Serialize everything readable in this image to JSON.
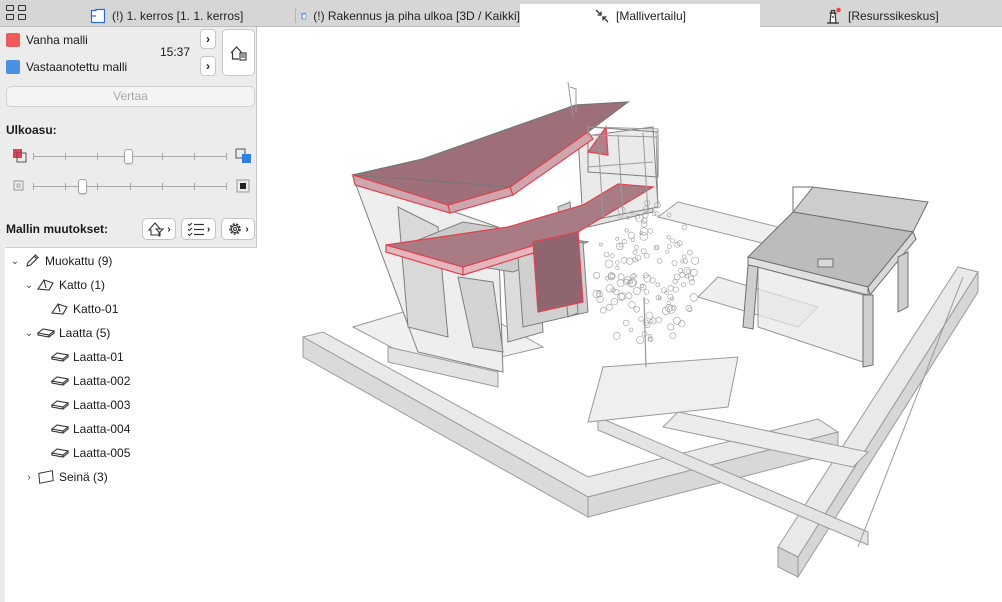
{
  "tabs": [
    {
      "label": "(!) 1. kerros [1. 1. kerros]",
      "icon": "floor-plan-icon"
    },
    {
      "label": "(!) Rakennus ja piha ulkoa [3D / Kaikki]",
      "icon": "3d-view-icon"
    },
    {
      "label": "[Mallivertailu]",
      "icon": "model-compare-icon"
    },
    {
      "label": "[Resurssikeskus]",
      "icon": "resource-center-icon"
    }
  ],
  "models": {
    "old_label": "Vanha malli",
    "old_color": "#f05a5a",
    "received_label": "Vastaanotettu malli",
    "received_color": "#4a90e2",
    "time": "15:37"
  },
  "compare_button": "Vertaa",
  "appearance": {
    "title": "Ulkoasu:",
    "slider1_value": 0.49,
    "slider2_value": 0.25
  },
  "changes": {
    "title": "Mallin muutokset:",
    "tree": {
      "root": {
        "label": "Muokattu (9)",
        "expanded": true
      },
      "groups": [
        {
          "label": "Katto (1)",
          "expanded": true,
          "icon": "roof-icon",
          "items": [
            {
              "label": "Katto-01",
              "icon": "roof-icon"
            }
          ]
        },
        {
          "label": "Laatta (5)",
          "expanded": true,
          "icon": "slab-icon",
          "items": [
            {
              "label": "Laatta-01",
              "icon": "slab-icon"
            },
            {
              "label": "Laatta-002",
              "icon": "slab-icon"
            },
            {
              "label": "Laatta-003",
              "icon": "slab-icon"
            },
            {
              "label": "Laatta-004",
              "icon": "slab-icon"
            },
            {
              "label": "Laatta-005",
              "icon": "slab-icon"
            }
          ]
        },
        {
          "label": "Seinä (3)",
          "expanded": false,
          "icon": "wall-icon",
          "items": []
        }
      ]
    }
  },
  "colors": {
    "accent_red": "#e0424e",
    "accent_blue": "#2f7fe6",
    "highlight_fill": "#a0707a"
  }
}
